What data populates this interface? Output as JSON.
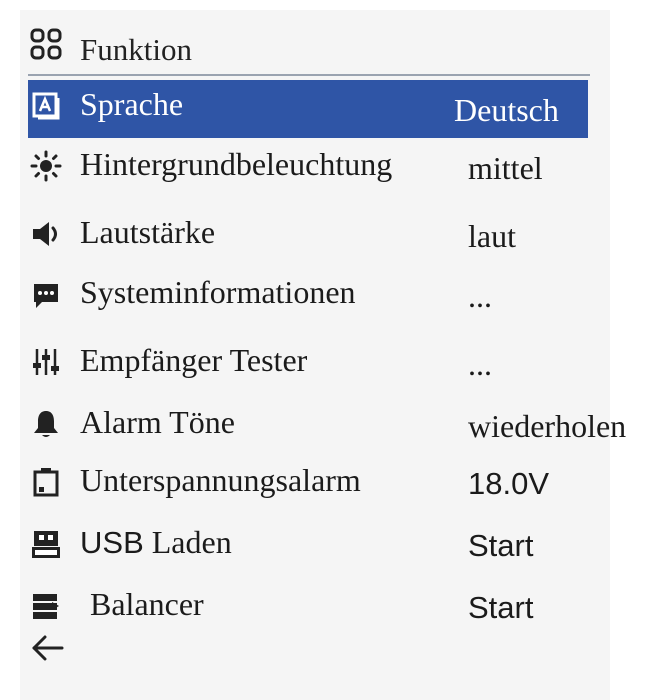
{
  "header": {
    "title": "Funktion",
    "icon": "grid-icon"
  },
  "menu": [
    {
      "label": "Sprache",
      "value": "Deutsch",
      "icon": "language-icon",
      "selected": true
    },
    {
      "label": "Hintergrundbeleuchtung",
      "value": "mittel",
      "icon": "brightness-icon"
    },
    {
      "label": "Lautstärke",
      "value": "laut",
      "icon": "speaker-icon"
    },
    {
      "label": "Systeminformationen",
      "value": "...",
      "icon": "chat-icon"
    },
    {
      "label": "Empfänger Tester",
      "value": "...",
      "icon": "sliders-icon"
    },
    {
      "label": "Alarm Töne",
      "value": "wiederholen",
      "icon": "bell-icon"
    },
    {
      "label": "Unterspannungsalarm",
      "value": "18.0V",
      "icon": "battery-icon"
    },
    {
      "label_prefix": "USB",
      "label": "Laden",
      "value": "Start",
      "icon": "usb-icon"
    },
    {
      "label": "Balancer",
      "value": "Start",
      "icon": "server-icon"
    }
  ],
  "footer": {
    "back_icon": "back-arrow-icon"
  },
  "colors": {
    "selected_bg": "#2f55a6",
    "selected_text": "#ffffff",
    "text": "#1b1b1b",
    "divider": "#9aa3b0"
  }
}
